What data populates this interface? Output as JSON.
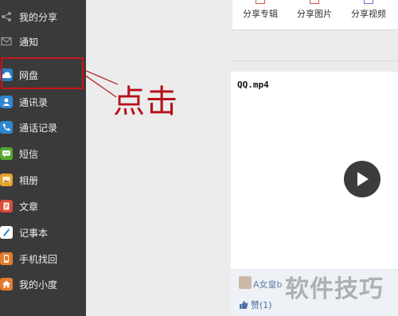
{
  "sidebar": {
    "items": [
      {
        "label": "我的分享",
        "icon": "share-icon",
        "color": "#888888"
      },
      {
        "label": "通知",
        "icon": "mail-icon",
        "color": "#888888"
      },
      {
        "label": "网盘",
        "icon": "cloud-icon",
        "color": "#4aa3df"
      },
      {
        "label": "通讯录",
        "icon": "contacts-icon",
        "color": "#2f86d0"
      },
      {
        "label": "通话记录",
        "icon": "phone-icon",
        "color": "#2f86d0"
      },
      {
        "label": "短信",
        "icon": "sms-icon",
        "color": "#55a530"
      },
      {
        "label": "相册",
        "icon": "photo-icon",
        "color": "#e6a02a"
      },
      {
        "label": "文章",
        "icon": "article-icon",
        "color": "#d84a3a"
      },
      {
        "label": "记事本",
        "icon": "notepad-icon",
        "color": "#2f86d0"
      },
      {
        "label": "手机找回",
        "icon": "find-phone-icon",
        "color": "#e37b2c"
      },
      {
        "label": "我的小度",
        "icon": "home-icon",
        "color": "#e37b2c"
      }
    ]
  },
  "toolbar": {
    "share_album": "分享专辑",
    "share_picture": "分享图片",
    "share_video": "分享视频"
  },
  "card": {
    "title": "QQ.mp4",
    "author": "A女皇b",
    "like": "赞(1)"
  },
  "annotation": {
    "click_text": "点击"
  },
  "watermark": "软件技巧",
  "colors": {
    "sidebar_bg": "#3a3a3a",
    "highlight": "#c9131b",
    "annotation": "#b4121a"
  }
}
